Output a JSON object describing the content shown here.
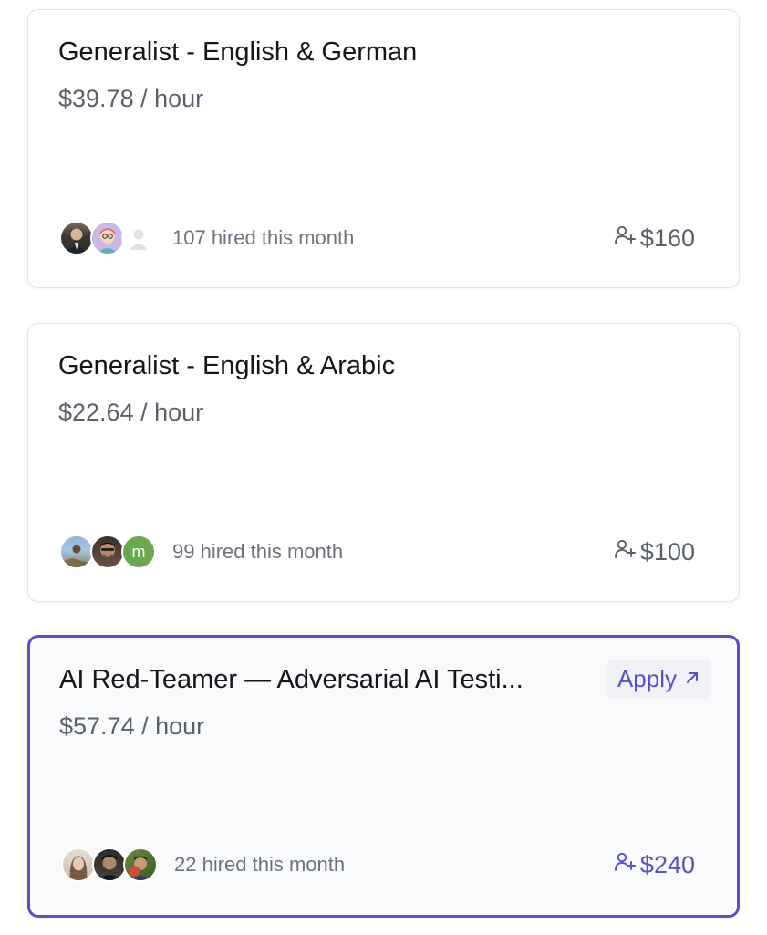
{
  "jobs": [
    {
      "title": "Generalist - English & German",
      "rate": "$39.78 / hour",
      "hired": "107 hired this month",
      "referral": "$160",
      "avatars": [
        "photo-avatar",
        "illustrated-avatar",
        "placeholder-avatar"
      ]
    },
    {
      "title": "Generalist - English & Arabic",
      "rate": "$22.64 / hour",
      "hired": "99 hired this month",
      "referral": "$100",
      "avatars": [
        "photo-avatar",
        "photo-avatar",
        "letter-avatar"
      ],
      "letter": "m"
    },
    {
      "title": "AI Red-Teamer — Adversarial AI Testi...",
      "rate": "$57.74 / hour",
      "hired": "22 hired this month",
      "referral": "$240",
      "apply_label": "Apply",
      "apply_icon": "arrow-up-right-icon",
      "avatars": [
        "photo-avatar",
        "photo-avatar",
        "photo-avatar"
      ]
    }
  ],
  "colors": {
    "accent": "#5b4fc6",
    "title": "#14161a",
    "muted": "#5a606b",
    "border": "#e2e4e8",
    "letter_avatar": "#6aa84f"
  }
}
